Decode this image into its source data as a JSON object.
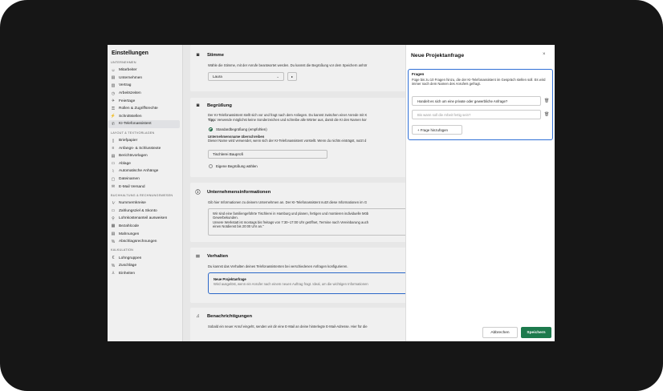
{
  "sidebar": {
    "title": "Einstellungen",
    "groups": [
      {
        "label": "Unternehmen",
        "items": [
          {
            "icon": "users-icon",
            "label": "Mitarbeiter"
          },
          {
            "icon": "building-icon",
            "label": "Unternehmen"
          },
          {
            "icon": "contract-icon",
            "label": "Vertrag"
          },
          {
            "icon": "clock-icon",
            "label": "Arbeitszeiten"
          },
          {
            "icon": "plane-icon",
            "label": "Feiertage"
          },
          {
            "icon": "key-icon",
            "label": "Rollen & Zugriffsrechte"
          },
          {
            "icon": "plug-icon",
            "label": "Schnittstellen"
          },
          {
            "icon": "phone-icon",
            "label": "KI-Telefonassistent"
          }
        ]
      },
      {
        "label": "Layout & Textvorlagen",
        "items": [
          {
            "icon": "letter-icon",
            "label": "Briefpapier"
          },
          {
            "icon": "text-icon",
            "label": "Anfangs- & Schlusstexte"
          },
          {
            "icon": "report-icon",
            "label": "Berichtsvorlagen"
          },
          {
            "icon": "folder-icon",
            "label": "Ablage"
          },
          {
            "icon": "attachment-icon",
            "label": "Automatische Anhänge"
          },
          {
            "icon": "file-icon",
            "label": "Dateinamen"
          },
          {
            "icon": "mail-icon",
            "label": "E-Mail Versand"
          }
        ]
      },
      {
        "label": "Buchhaltung & Rechnungswesen",
        "items": [
          {
            "icon": "number-icon",
            "label": "Nummernkreise"
          },
          {
            "icon": "card-icon",
            "label": "Zahlungsziel & Skonto"
          },
          {
            "icon": "wage-icon",
            "label": "Lohnkostenanteil ausweisen"
          },
          {
            "icon": "qr-icon",
            "label": "Bezahlcode"
          },
          {
            "icon": "reminder-icon",
            "label": "Mahnungen"
          },
          {
            "icon": "percent-icon",
            "label": "Abschlagsrechnungen"
          }
        ]
      },
      {
        "label": "Kalkulation",
        "items": [
          {
            "icon": "euro-icon",
            "label": "Lohngruppen"
          },
          {
            "icon": "percent-icon",
            "label": "Zuschläge"
          },
          {
            "icon": "unit-icon",
            "label": "Einheiten"
          }
        ]
      }
    ]
  },
  "main": {
    "voice": {
      "title": "Stimme",
      "desc": "Wähle die Stimme, mit der Anrufe beantwortet werden. Du kannst die Begrüßung vor dem Speichern anhör",
      "select_value": "Laura"
    },
    "greeting": {
      "title": "Begrüßung",
      "desc": "Der KI-Telefonassistent stellt sich vor und fragt nach dem Anliegen. Du kannst zwischen einer Anrede mit K",
      "tip_label": "Tipp:",
      "tip": " Verwende möglichst keine Sonderzeichen und schreibe alle Wörter aus, damit die KI den Namen kor",
      "option_standard": "Standardbegrüßung (empfohlen)",
      "override_label": "Unternehmensname überschreiben",
      "override_desc": "Dieser Name wird verwendet, wenn sich der KI-Telefonassistent vorstellt. Wenn du nichts einträgst, nutzt d",
      "name_value": "Tischlerei Bauprofi",
      "option_custom": "Eigene Begrüßung wählen"
    },
    "company": {
      "title": "Unternehmensinformationen",
      "desc": "Gib hier Informationen zu deinem Unternehmen an. Der KI-Telefonassistent nutzt diese Informationen im G",
      "text_lines": [
        "Wir sind eine familiengeführte Tischlerei in Hamburg und planen, fertigen und montieren individuelle Möb",
        "Gewerbekunden.",
        "Unsere Werkstatt ist montags bis freitags von 7:30–17:00 Uhr geöffnet, Termine nach Vereinbarung auch",
        "einen Notdienst bis 20:00 Uhr an.\""
      ]
    },
    "behavior": {
      "title": "Verhalten",
      "desc": "Du kannst das Verhalten deines Telefonassistenten bei verschiedenen Anfragen konfigurieren.",
      "card_title": "Neue Projektanfrage",
      "card_desc": "Wird ausgelöst, wenn ein Anrufer nach einem neuen Auftrag fragt. Ideal, um die wichtigen Informationen"
    },
    "notifications": {
      "title": "Benachrichtigungen",
      "desc": "Sobald ein neuer Anruf eingeht, senden wir dir eine E-Mail an deine hinterlegte E-Mail-Adresse. Hier für die"
    }
  },
  "panel": {
    "title": "Neue Projektanfrage",
    "close": "×",
    "questions_label": "Fragen",
    "questions_help": "Füge bis zu 10 Fragen hinzu, die der KI-Telefonassistent im Gespräch stellen soll. Es wird immer nach dem Namen des Anrufers gefragt.",
    "question_1_value": "Handelt es sich um eine private oder gewerbliche Anfrage?",
    "question_2_placeholder": "Bis wann soll die Arbeit fertig sein?",
    "add_question": "+ Frage hinzufügen",
    "cancel": "Abbrechen",
    "save": "Speichern"
  }
}
